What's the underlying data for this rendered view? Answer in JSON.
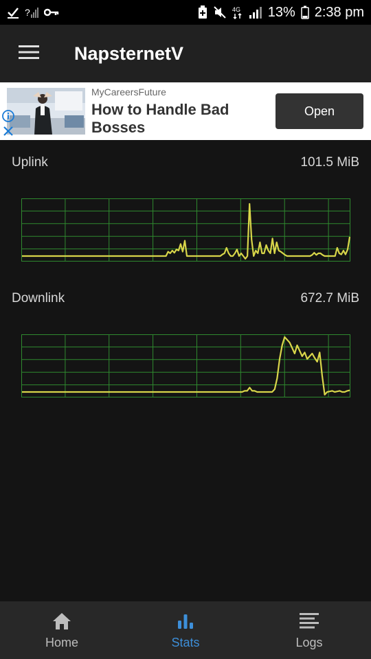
{
  "status_bar": {
    "battery_percent": "13%",
    "time": "2:38 pm",
    "network": "4G"
  },
  "app_bar": {
    "title": "NapsternetV"
  },
  "ad": {
    "advertiser": "MyCareersFuture",
    "headline": "How to Handle Bad Bosses",
    "cta": "Open"
  },
  "stats": {
    "uplink": {
      "label": "Uplink",
      "value": "101.5 MiB"
    },
    "downlink": {
      "label": "Downlink",
      "value": "672.7 MiB"
    }
  },
  "bottom_nav": {
    "items": [
      {
        "label": "Home",
        "icon": "home-icon",
        "active": false
      },
      {
        "label": "Stats",
        "icon": "bar-chart-icon",
        "active": true
      },
      {
        "label": "Logs",
        "icon": "list-icon",
        "active": false
      }
    ]
  },
  "colors": {
    "accent": "#3d8fd9",
    "graph_line": "#d9d64a",
    "graph_grid": "#2f8a2f"
  },
  "chart_data": [
    {
      "type": "line",
      "series": [
        {
          "values": [
            0,
            0,
            0,
            0,
            0,
            0,
            0,
            0,
            0,
            0,
            0,
            0,
            0,
            0,
            0,
            0,
            0,
            0,
            0,
            0,
            0,
            0,
            0,
            0,
            0,
            0,
            0,
            0,
            0,
            0,
            0,
            0,
            0,
            0,
            0,
            0,
            0,
            0,
            0,
            0,
            0,
            0,
            0,
            0,
            0,
            0,
            0,
            0,
            0,
            0,
            0,
            0,
            0,
            0,
            0,
            0,
            0,
            0,
            0,
            0,
            0,
            0,
            0,
            0,
            0,
            0,
            0,
            0,
            0,
            0,
            0.08,
            0.05,
            0.1,
            0.06,
            0.12,
            0.1,
            0.22,
            0.08,
            0.28,
            0,
            0,
            0,
            0,
            0,
            0,
            0,
            0,
            0,
            0,
            0,
            0,
            0,
            0,
            0,
            0,
            0,
            0.03,
            0.05,
            0.15,
            0.05,
            0,
            0,
            0.05,
            0.12,
            0,
            0.05,
            0,
            -0.05,
            0,
            0.95,
            0.3,
            0,
            0.1,
            0.05,
            0.25,
            0.05,
            0.05,
            0.2,
            0.1,
            0.05,
            0.32,
            0.05,
            0.25,
            0.1,
            0.08,
            0.05,
            0.02,
            0,
            0,
            0,
            0,
            0,
            0,
            0,
            0,
            0,
            0,
            0,
            0,
            0.02,
            0.06,
            0.02,
            0.05,
            0.05,
            0.02,
            0,
            0,
            0,
            0,
            0,
            0,
            0.15,
            0.05,
            0.03,
            0.1,
            0.03,
            0.12,
            0.35
          ]
        }
      ],
      "ylim": [
        -0.1,
        1.1
      ],
      "grid": true
    },
    {
      "type": "line",
      "series": [
        {
          "values": [
            0,
            0,
            0,
            0,
            0,
            0,
            0,
            0,
            0,
            0,
            0,
            0,
            0,
            0,
            0,
            0,
            0,
            0,
            0,
            0,
            0,
            0,
            0,
            0,
            0,
            0,
            0,
            0,
            0,
            0,
            0,
            0,
            0,
            0,
            0,
            0,
            0,
            0,
            0,
            0,
            0,
            0,
            0,
            0,
            0,
            0,
            0,
            0,
            0,
            0,
            0,
            0,
            0,
            0,
            0,
            0,
            0,
            0,
            0,
            0,
            0,
            0,
            0,
            0,
            0,
            0,
            0,
            0,
            0,
            0,
            0,
            0,
            0,
            0,
            0,
            0,
            0,
            0,
            0,
            0,
            0,
            0,
            0,
            0,
            0,
            0,
            0,
            0,
            0,
            0.02,
            0.02,
            0.08,
            0.02,
            0.02,
            0,
            0,
            0,
            0,
            0,
            0,
            0,
            0.05,
            0.25,
            0.6,
            0.85,
            1.0,
            0.95,
            0.9,
            0.8,
            0.7,
            0.85,
            0.75,
            0.65,
            0.72,
            0.6,
            0.65,
            0.7,
            0.62,
            0.55,
            0.72,
            0.3,
            -0.05,
            0,
            0.01,
            0.02,
            0,
            0.01,
            0.02,
            0,
            0,
            0.02,
            0.03
          ]
        }
      ],
      "ylim": [
        -0.1,
        1.1
      ],
      "grid": true
    }
  ]
}
